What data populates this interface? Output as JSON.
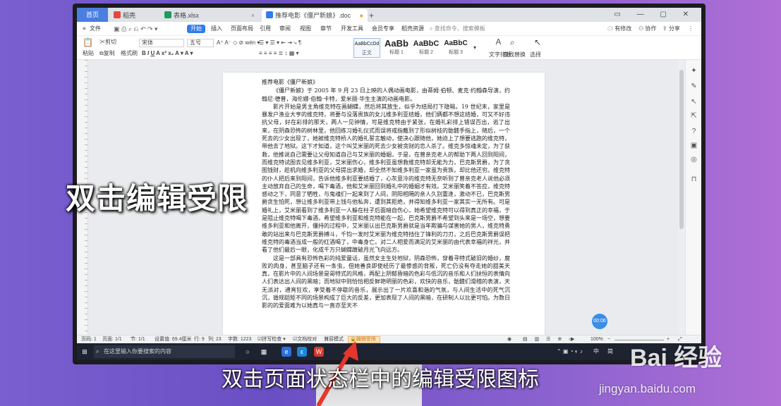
{
  "tabs": {
    "home": "首页",
    "t1": "稻壳",
    "t2": "表格.xlsx",
    "t3": "推荐电影《僵尸新娘》.doc"
  },
  "menu": {
    "file": "文件",
    "items": [
      "开始",
      "插入",
      "页面布局",
      "引用",
      "审阅",
      "视图",
      "章节",
      "开发工具",
      "会员专享",
      "稻壳资源"
    ],
    "search": "查找命令、搜索模板",
    "changes": "有修改",
    "collab": "协作",
    "share": "分享"
  },
  "ribbon": {
    "paste": "粘贴",
    "cut": "剪切",
    "copy": "复制",
    "format_brush": "格式刷",
    "font_name": "宋体",
    "font_size": "五号",
    "styles": [
      {
        "sample": "AaBbCcDd",
        "label": "正文"
      },
      {
        "sample": "AaBb",
        "label": "标题 1"
      },
      {
        "sample": "AaBbC",
        "label": "标题 2"
      },
      {
        "sample": "AaBbC",
        "label": "标题 3"
      }
    ],
    "text_layout": "文字排版",
    "find_replace": "查找替换",
    "select": "选择"
  },
  "document": {
    "title": "推荐电影《僵尸新娘》",
    "paragraphs": [
      "《僵尸新娘》于 2005 年 9 月 23 日上映的人偶动画电影，由蒂姆·伯顿、麦克·约翰森导演，约翰尼·德普，海伦娜·伯翰·卡特，爱米丽·华生主演的动画电影。",
      "影片开始是男主角维克特在画蝴蝶，然后将其放生，似乎为结局打下隐喻。19 世纪末，家里是暴发户渔业大亨的维克特，将要与没落贵族的女儿维多利亚结婚，他们俩都不想这结婚，可又不好违抗父母，好在彩排的那天，两人一见钟情，可是维克特由于紧张，在婚礼彩排上错误百出，逃了出来，在阴森恐怖的树林里，他回练习婚礼仪式而误将戒指戴到了形似树枝的骷髅手指上，随后，一个死去的少女出现了，她被维克特桥人的婚礼誓言触动，使决心跟随他，她迫上了想要逃跑的维克特，带他去了地狱。这下才知道，这个叫艾米丽的死去少女被贪财的恋人杀了。维克多惊魂未定，为了获救，他推说自己需要让父母知道自己与艾米丽的婚姻，于是，在曾亲克老人的帮助下两人回到阳间，而维克特试图去见维多利亚，艾米丽伤心，维多利亚虽想救维克特却无能为力，巴克斯男爵，为了贪图钱财，趁机向维多利亚的父母提出求婚，却全然不知维多利亚一家虽为贵族，却比他还穷。维克特的仆人把后来到阳间，告诉他维多利亚要结婚了，心灰意冷的维克特无奈听到了曾亲克老人说他必须主动放弃自己的生命，喝下毒酒，他和艾米丽回到婚礼中的婚姻才有效。艾米丽笑着不答应，维克特感动之下，同意了牺牲，与鬼魂们一起来到了人间，阴阳相隔的亲人久别重逢，激动不已，巴克斯男爵贪生怕死，想让维多利亚带上钱与他私奔，遭到其拒绝，并得知维多利亚一家其实一无所有。可是婚礼上，艾米丽看到了维多利亚一人躲在柱子后面暗自伤心，她希望维克特可以得到真正的幸福，于是阻止维克特喝下毒酒，希望维多利亚和维克特能在一起，巴克斯男爵不希望到头来是一场空，想要维多利亚和他离开，僵持的过程中，艾米丽认出巴克斯男爵就是当年欺骗与谋害她的男人，维克特勇敢的站出来与巴克斯男爵搏斗，千钧一发时艾米丽为维克特挡住了锋利的刀刃，之后巴克斯男爵误把维克特的毒酒当成一般的红酒喝了，中毒身亡。对二人相爱而满足的艾米丽的由代表幸福的祥光，并看了他们最后一眼，化成千万只蝴蝶踱破月光飞向远方。",
      "这是一部具有恐怖色彩的纯爱童话，虽然女主生处地狱，阴森恐怖，穿着寻特式破旧的婚纱，腐败的肉身，甚至脑子还有一条虫，但她善良即使经历了最惨惑的背叛，死亡仍没有夺走她的甜美天真，在影片中的人间场景是哥特式的风格，再配上阴郁昏暗的色彩与低沉的音乐和人们扶恒的表情向人们表达出人间的黑暗；而地狱中则恰恰相反鲜艳明丽的色彩，欢快的音乐，骷髅们滑稽的表演，天无派对，通宵狂欢，享受着不停歇的音乐，展示出了一片欢喜和谐的气氛，与人间生活中的死气沉沉，循规蹈矩不同的场景构成了巨大的反差，更加表现了人间的黑暗，在研制人以比更可怕。为数日影的的爱面难为以她真与一直亦至天不"
    ]
  },
  "statusbar": {
    "page": "页码: 1",
    "pages": "页面: 1/1",
    "section": "节: 1/1",
    "setting": "设置值: 69.4厘米",
    "row": "行: 9",
    "col": "列: 23",
    "words": "字数: 1223",
    "spellcheck": "拼写检查",
    "proof": "文档校对",
    "compat": "兼容模式",
    "restrict": "编辑受限",
    "zoom": "100%"
  },
  "taskbar": {
    "search_placeholder": "在这里输入你要搜索的内容",
    "ime": "中",
    "lang": "简"
  },
  "timer": "00:06",
  "overlay": {
    "big_caption": "双击编辑受限",
    "bottom_caption": "双击页面状态栏中的编辑受限图标",
    "watermark_brand": "Bai 经验",
    "watermark_url": "jingyan.baidu.com"
  },
  "colors": {
    "accent": "#2f7bf0",
    "restrict_highlight": "#f0b36a",
    "arrow": "#e8352b"
  }
}
